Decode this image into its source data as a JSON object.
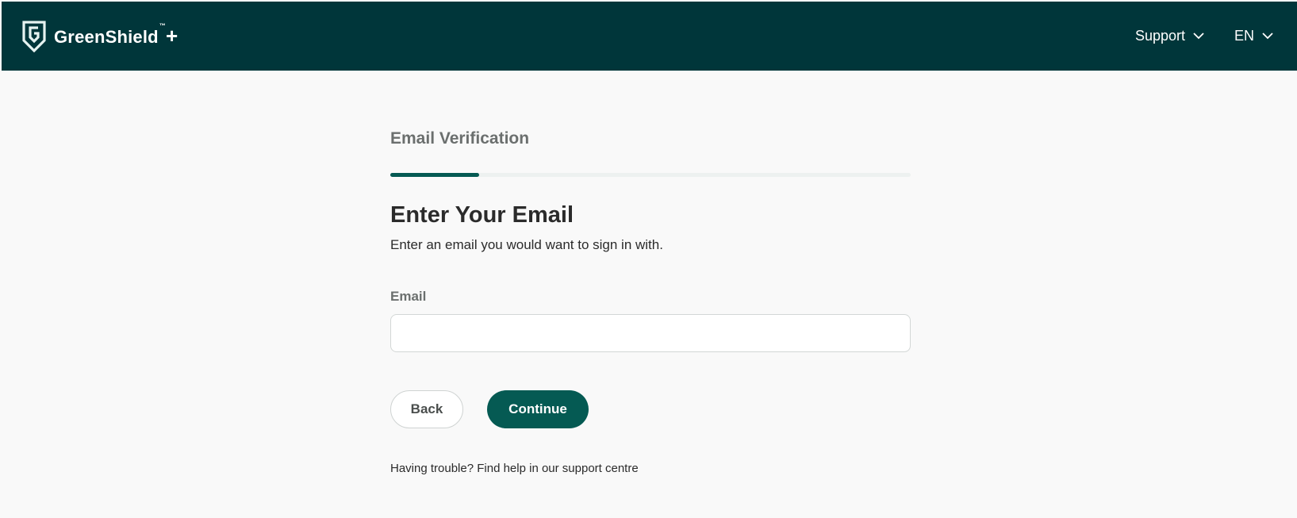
{
  "header": {
    "brand_name": "GreenShield",
    "brand_tm": "™",
    "brand_plus": "+",
    "logo_icon": "shield-g-icon",
    "nav": [
      {
        "label": "Support",
        "icon": "chevron-down-icon"
      },
      {
        "label": "EN",
        "icon": "chevron-down-icon"
      }
    ]
  },
  "main": {
    "step_title": "Email Verification",
    "progress_fraction": 0.17,
    "heading": "Enter Your Email",
    "subtext": "Enter an email you would want to sign in with.",
    "email_label": "Email",
    "email_value": "",
    "email_placeholder": "",
    "back_label": "Back",
    "continue_label": "Continue",
    "help_text": "Having trouble? Find help in our support centre"
  },
  "colors": {
    "header_bg": "#00363a",
    "accent": "#055a53",
    "page_bg": "#f9f9f9",
    "progress_track": "#edf1f0"
  }
}
